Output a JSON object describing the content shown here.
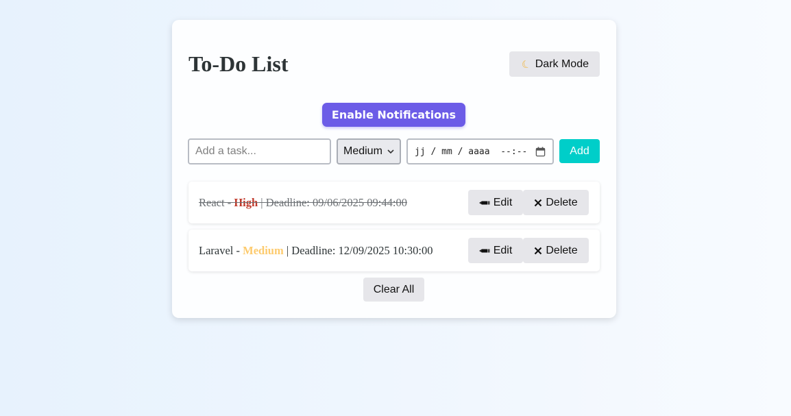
{
  "header": {
    "title": "To-Do List",
    "dark_mode_label": "Dark Mode",
    "dark_mode_icon": "moon-icon"
  },
  "notifications": {
    "button_label": "Enable Notifications"
  },
  "form": {
    "task_placeholder": "Add a task...",
    "task_value": "",
    "priority_selected": "Medium",
    "date_display": "jj / mm / aaaa  --:--",
    "add_label": "Add"
  },
  "tasks": [
    {
      "name": "React",
      "sep": " - ",
      "priority": "High",
      "deadline_text": " | Deadline: 09/06/2025 09:44:00",
      "completed": true,
      "edit_label": "Edit",
      "delete_label": "Delete"
    },
    {
      "name": "Laravel",
      "sep": " - ",
      "priority": "Medium",
      "deadline_text": " | Deadline: 12/09/2025 10:30:00",
      "completed": false,
      "edit_label": "Edit",
      "delete_label": "Delete"
    }
  ],
  "clear_all_label": "Clear All",
  "colors": {
    "accent_purple": "#6c5ce7",
    "add_teal": "#00cec9",
    "priority_high": "#c0392b",
    "priority_medium": "#fdcb6e"
  }
}
